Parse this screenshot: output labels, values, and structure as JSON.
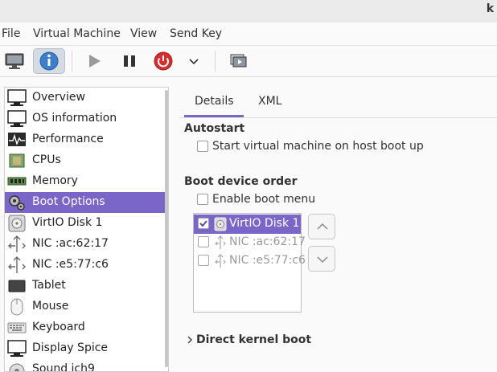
{
  "window": {
    "title_fragment": "k"
  },
  "menubar": {
    "items": [
      "File",
      "Virtual Machine",
      "View",
      "Send Key"
    ]
  },
  "toolbar": {
    "buttons": [
      "console-icon",
      "info-icon",
      "play-icon",
      "pause-icon",
      "power-icon",
      "chevron-down-icon",
      "snapshot-icon"
    ],
    "active": "info-icon",
    "colors": {
      "power": "#d32f2f",
      "info": "#3d7fc9"
    }
  },
  "sidebar": {
    "selected_color": "#7a66c7",
    "items": [
      {
        "label": "Overview",
        "icon": "monitor-icon"
      },
      {
        "label": "OS information",
        "icon": "monitor-icon"
      },
      {
        "label": "Performance",
        "icon": "performance-graph-icon"
      },
      {
        "label": "CPUs",
        "icon": "cpu-chip-icon"
      },
      {
        "label": "Memory",
        "icon": "memory-module-icon"
      },
      {
        "label": "Boot Options",
        "icon": "gears-icon",
        "selected": true
      },
      {
        "label": "VirtIO Disk 1",
        "icon": "disk-icon"
      },
      {
        "label": "NIC :ac:62:17",
        "icon": "network-icon"
      },
      {
        "label": "NIC :e5:77:c6",
        "icon": "network-icon"
      },
      {
        "label": "Tablet",
        "icon": "tablet-icon"
      },
      {
        "label": "Mouse",
        "icon": "mouse-icon"
      },
      {
        "label": "Keyboard",
        "icon": "keyboard-icon"
      },
      {
        "label": "Display Spice",
        "icon": "display-icon"
      },
      {
        "label": "Sound ich9",
        "icon": "sound-icon"
      }
    ]
  },
  "tabs": {
    "details": "Details",
    "xml": "XML",
    "active": "Details"
  },
  "autostart": {
    "title": "Autostart",
    "checkbox_label": "Start virtual machine on host boot up",
    "checked": false
  },
  "boot_order": {
    "title": "Boot device order",
    "enable_menu_label": "Enable boot menu",
    "enable_menu_checked": false,
    "devices": [
      {
        "label": "VirtIO Disk 1",
        "checked": true,
        "selected": true,
        "icon": "disk-icon"
      },
      {
        "label": "NIC :ac:62:17",
        "checked": false,
        "selected": false,
        "icon": "network-icon"
      },
      {
        "label": "NIC :e5:77:c6",
        "checked": false,
        "selected": false,
        "icon": "network-icon"
      }
    ]
  },
  "direct_kernel": {
    "title": "Direct kernel boot",
    "expanded": false
  }
}
